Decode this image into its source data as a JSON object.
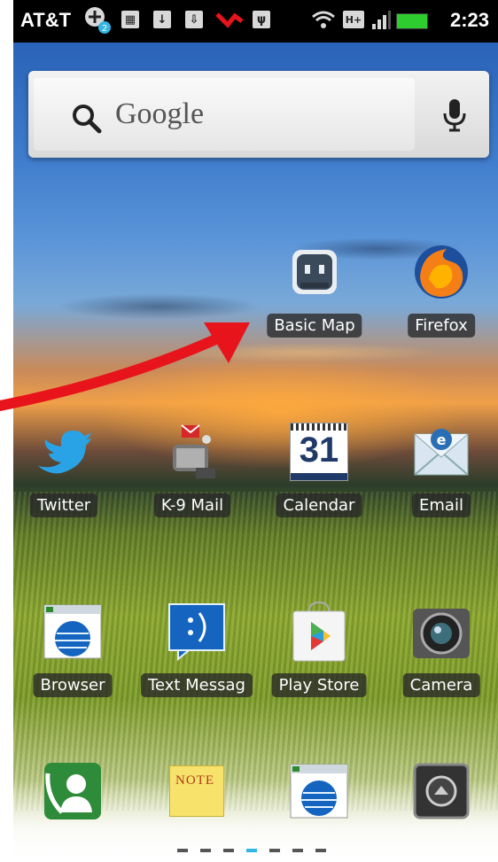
{
  "status_bar": {
    "carrier": "AT&T",
    "time": "2:23",
    "network": "H+",
    "notification_badge": "2"
  },
  "search": {
    "placeholder": "Google"
  },
  "apps": [
    {
      "label": "Basic Map",
      "icon": "basic-map-icon"
    },
    {
      "label": "Firefox",
      "icon": "firefox-icon"
    },
    {
      "label": "Twitter",
      "icon": "twitter-icon"
    },
    {
      "label": "K-9 Mail",
      "icon": "k9-mail-icon"
    },
    {
      "label": "Calendar",
      "icon": "calendar-icon",
      "day": "31"
    },
    {
      "label": "Email",
      "icon": "email-icon"
    },
    {
      "label": "Browser",
      "icon": "browser-icon"
    },
    {
      "label": "Text Messag",
      "icon": "text-messaging-icon"
    },
    {
      "label": "Play Store",
      "icon": "play-store-icon"
    },
    {
      "label": "Camera",
      "icon": "camera-icon"
    }
  ],
  "dock": [
    {
      "icon": "phone-icon"
    },
    {
      "icon": "note-icon",
      "text": "NOTE"
    },
    {
      "icon": "browser-icon"
    },
    {
      "icon": "app-drawer-icon"
    }
  ],
  "page_indicator": {
    "pages": 7,
    "current": 4
  },
  "colors": {
    "arrow": "#e8141b",
    "indicator_active": "#33b5e5",
    "label_bg": "#282828"
  }
}
